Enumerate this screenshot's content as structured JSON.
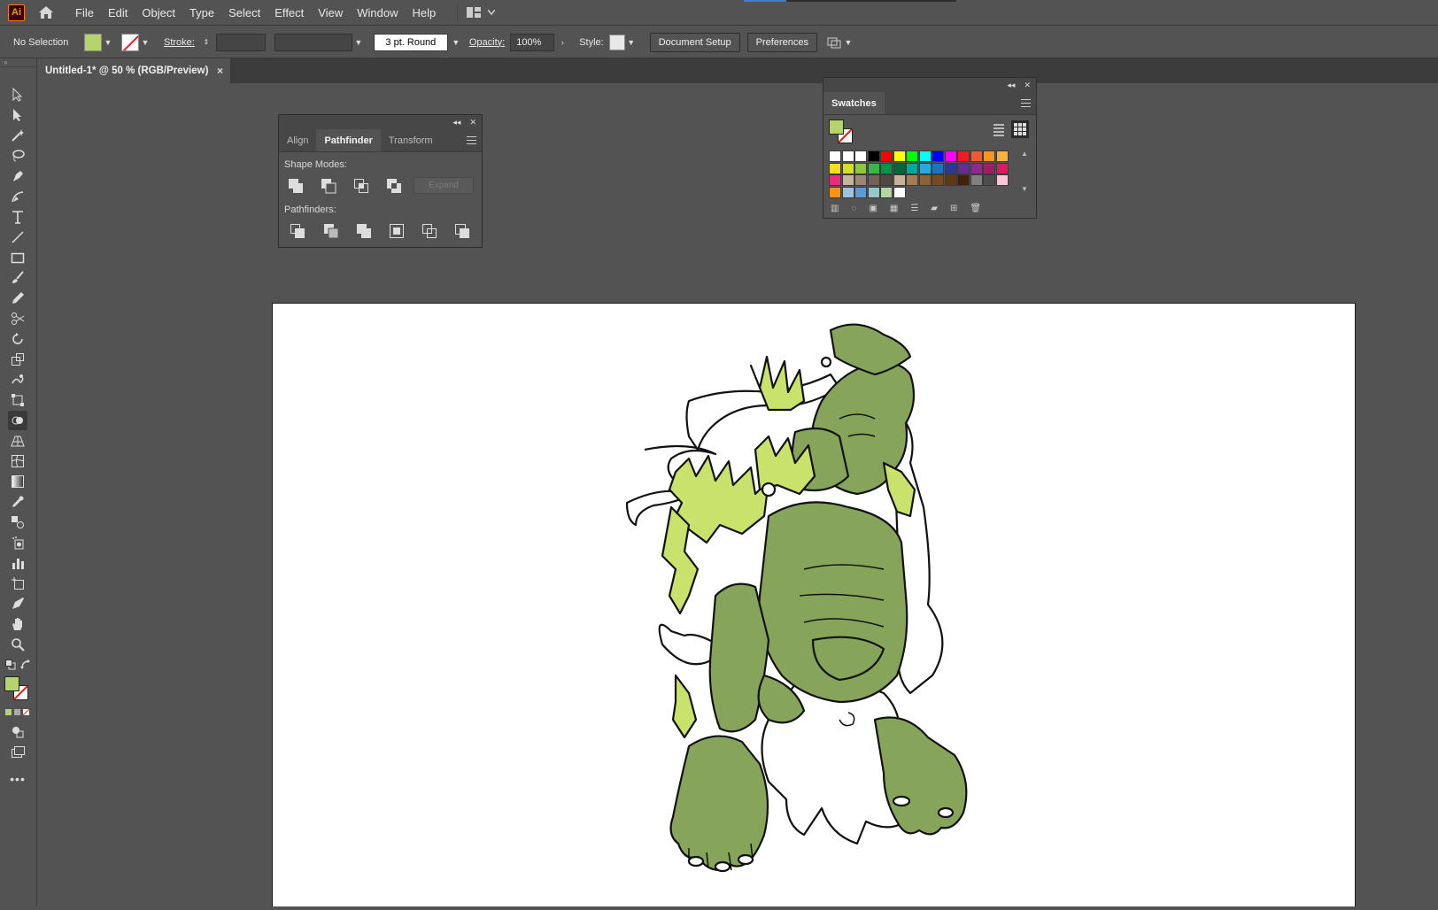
{
  "app": {
    "logo": "Ai",
    "home_icon": "home-icon"
  },
  "menu": [
    "File",
    "Edit",
    "Object",
    "Type",
    "Select",
    "Effect",
    "View",
    "Window",
    "Help"
  ],
  "control": {
    "selection": "No Selection",
    "stroke_label": "Stroke:",
    "brush": "3 pt. Round",
    "opacity_label": "Opacity:",
    "opacity_value": "100%",
    "style_label": "Style:",
    "document_setup": "Document Setup",
    "preferences": "Preferences",
    "fill_color": "#b5d46c"
  },
  "document": {
    "tab_title": "Untitled-1* @ 50 % (RGB/Preview)",
    "close": "×"
  },
  "pathfinder_panel": {
    "tabs": [
      "Align",
      "Pathfinder",
      "Transform"
    ],
    "active_tab": "Pathfinder",
    "shape_modes_label": "Shape Modes:",
    "expand_label": "Expand",
    "pathfinders_label": "Pathfinders:"
  },
  "swatches_panel": {
    "title": "Swatches",
    "rows": [
      [
        "#ffffff",
        "#ffffff",
        "#ffffff",
        "#000000",
        "#ff0000",
        "#ffff00",
        "#00ff00",
        "#00ffff",
        "#0000ff",
        "#ff00ff",
        "#ee1d24",
        "#f15a29",
        "#f7941d",
        "#fbb040"
      ],
      [
        "#ffde17",
        "#d7df23",
        "#8dc63f",
        "#39b54a",
        "#009444",
        "#006838",
        "#00a79d",
        "#27aae1",
        "#1c75bc",
        "#2b3990",
        "#662d91",
        "#92278f",
        "#9e1f63",
        "#da1c5c"
      ],
      [
        "#ee2a7b",
        "#c2b59b",
        "#998675",
        "#736357",
        "#534741",
        "#c7b299",
        "#a67c52",
        "#8c6239",
        "#754c24",
        "#603913",
        "#42210b",
        "#808080",
        "#4d4d4d",
        "#f7c6d9"
      ],
      [
        "#f7941d",
        "#9bc4e2",
        "#5b9bd5",
        "#95c8c8",
        "#b3d5a0",
        "#ffffff"
      ]
    ]
  }
}
